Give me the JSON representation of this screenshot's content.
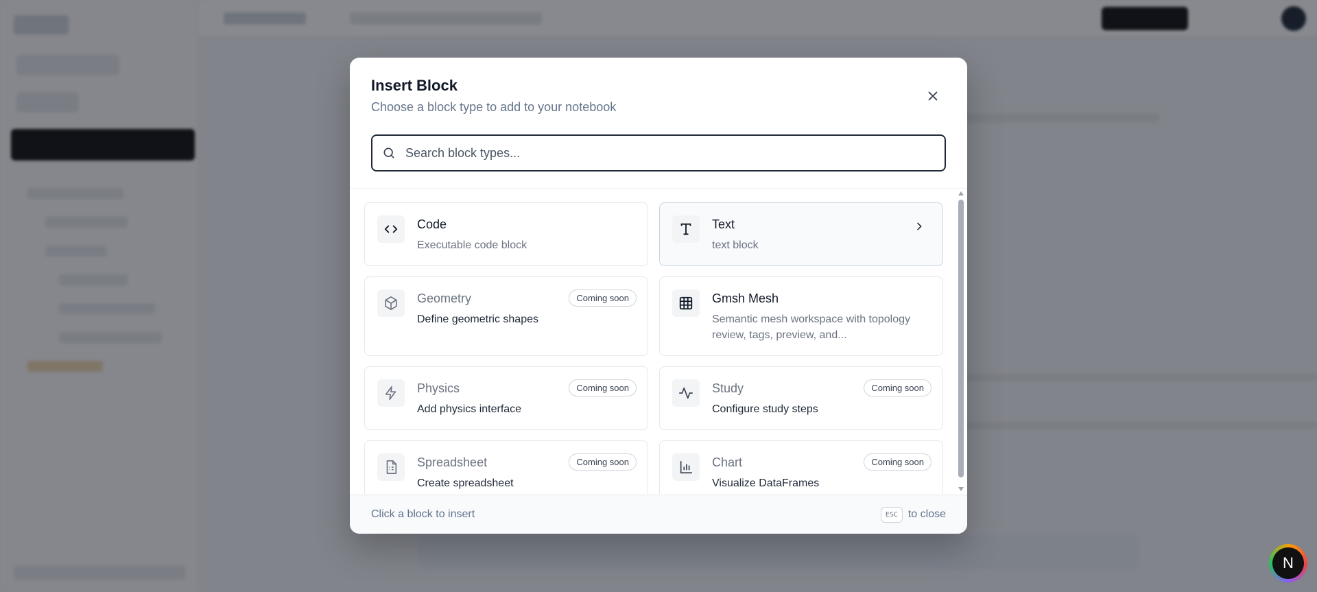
{
  "modal": {
    "title": "Insert Block",
    "subtitle": "Choose a block type to add to your notebook",
    "search_placeholder": "Search block types...",
    "search_value": "",
    "close_icon": "x-icon"
  },
  "blocks": [
    {
      "name": "Code",
      "description": "Executable code block",
      "icon": "code-icon",
      "available": true,
      "badge": ""
    },
    {
      "name": "Text",
      "description": "text block",
      "icon": "text-icon",
      "available": true,
      "badge": "",
      "selected": true
    },
    {
      "name": "Geometry",
      "description": "Define geometric shapes",
      "icon": "cube-icon",
      "available": false,
      "badge": "Coming soon"
    },
    {
      "name": "Gmsh Mesh",
      "description": "Semantic mesh workspace with topology review, tags, preview, and...",
      "icon": "grid-icon",
      "available": true,
      "badge": ""
    },
    {
      "name": "Physics",
      "description": "Add physics interface",
      "icon": "zap-icon",
      "available": false,
      "badge": "Coming soon"
    },
    {
      "name": "Study",
      "description": "Configure study steps",
      "icon": "activity-icon",
      "available": false,
      "badge": "Coming soon"
    },
    {
      "name": "Spreadsheet",
      "description": "Create spreadsheet",
      "icon": "sheet-icon",
      "available": false,
      "badge": "Coming soon"
    },
    {
      "name": "Chart",
      "description": "Visualize DataFrames",
      "icon": "bar-chart-icon",
      "available": false,
      "badge": "Coming soon"
    }
  ],
  "footer": {
    "hint": "Click a block to insert",
    "key": "ESC",
    "key_action": "to close"
  },
  "next_badge": {
    "letter": "N"
  }
}
